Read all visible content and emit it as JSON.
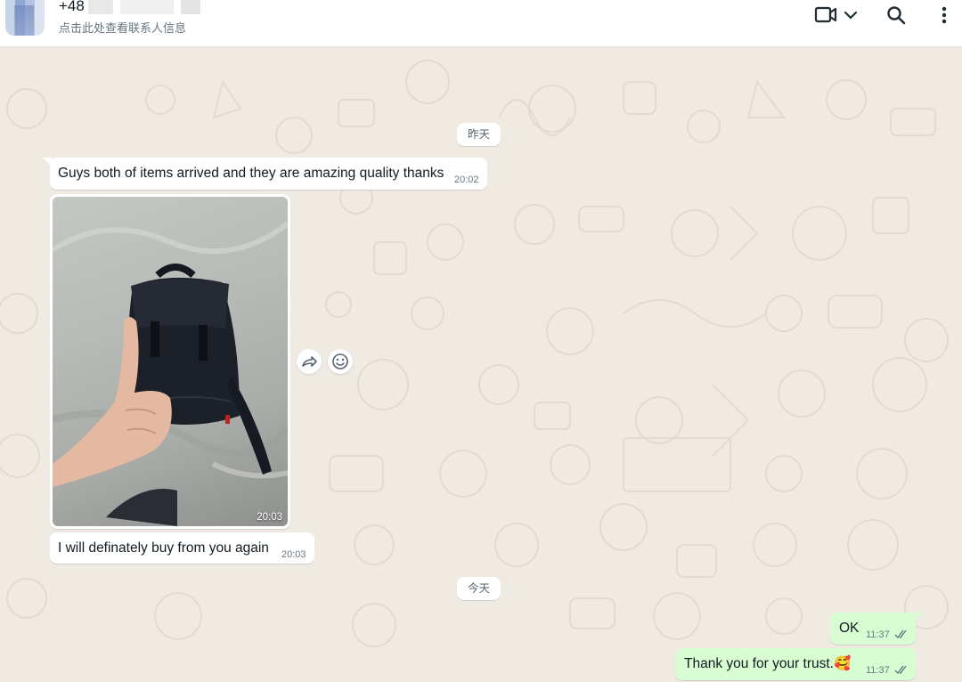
{
  "header": {
    "contact_name": "+48",
    "contact_subtitle": "点击此处查看联系人信息",
    "icons": [
      "video-call-icon",
      "chevron-down-icon",
      "search-icon",
      "menu-icon"
    ]
  },
  "messages": {
    "yesterday_label": "昨天",
    "today_label": "今天",
    "in1": {
      "text": "Guys both of items arrived and they are amazing quality thanks",
      "time": "20:02"
    },
    "photo": {
      "time": "20:03"
    },
    "in2": {
      "text": "I will definately buy from you again",
      "time": "20:03"
    },
    "out1": {
      "text": "OK",
      "time": "11:37"
    },
    "out2": {
      "text": "Thank you for your trust.🥰",
      "time": "11:37"
    }
  },
  "colors": {
    "chat_background": "#efeae2",
    "incoming_bubble": "#ffffff",
    "outgoing_bubble": "#d9fdd3",
    "read_ticks": "#667781"
  }
}
